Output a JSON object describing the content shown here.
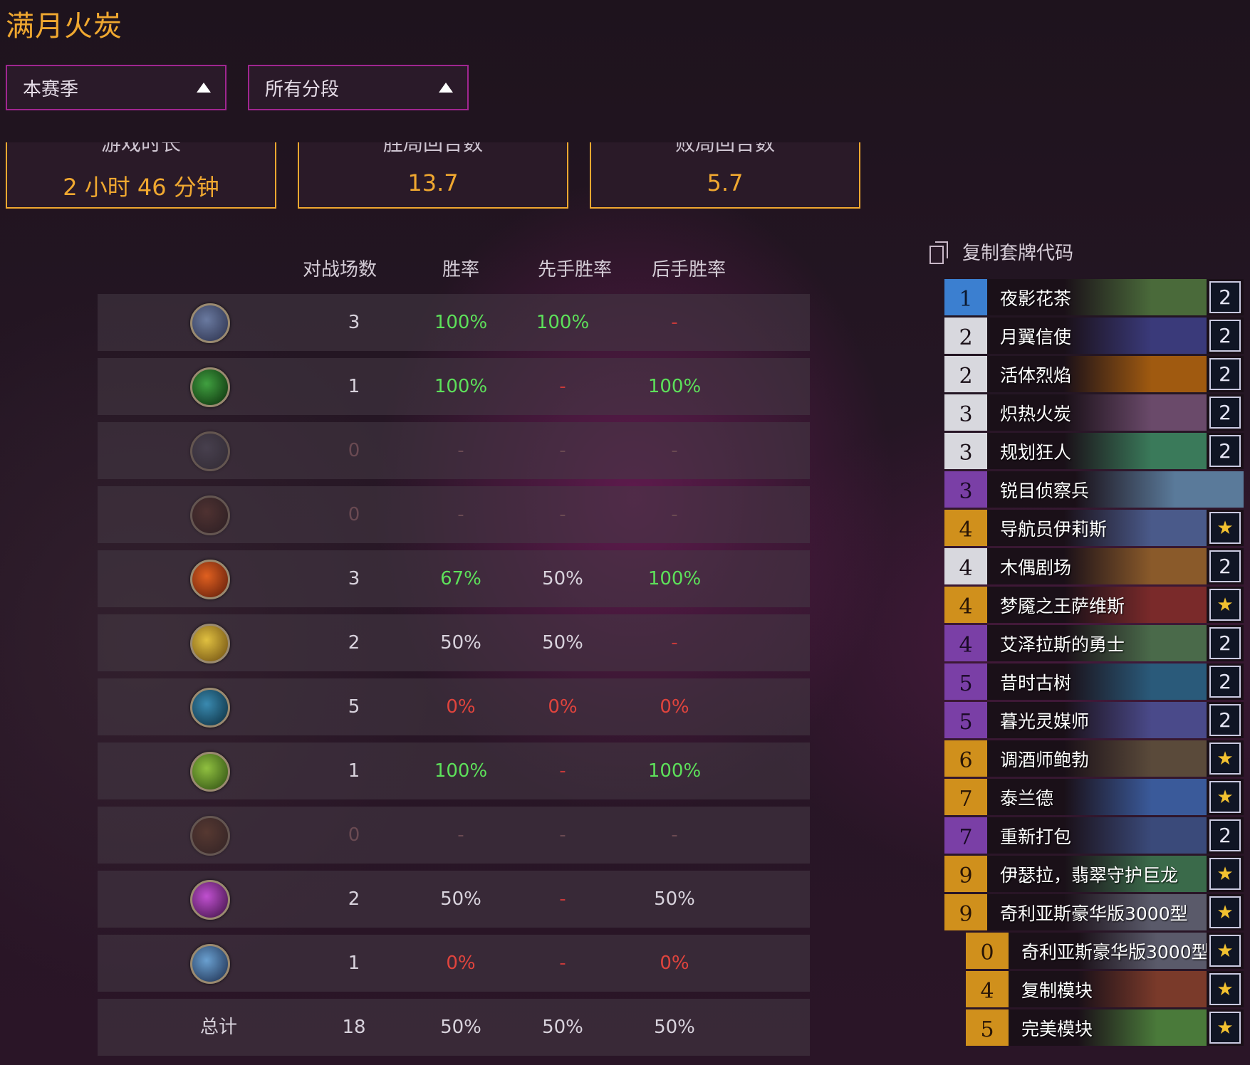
{
  "page": {
    "title": "满月火炭"
  },
  "filters": {
    "season": "本赛季",
    "rank": "所有分段"
  },
  "stats": [
    {
      "label": "游戏时长",
      "value": "2 小时 46 分钟"
    },
    {
      "label": "胜局回合数",
      "value": "13.7"
    },
    {
      "label": "败局回合数",
      "value": "5.7"
    }
  ],
  "table": {
    "headers": [
      "对战场数",
      "胜率",
      "先手胜率",
      "后手胜率"
    ],
    "rows": [
      {
        "icon": "class-icon-1",
        "games": "3",
        "winrate": "100%",
        "first": "100%",
        "second": "-"
      },
      {
        "icon": "class-icon-2",
        "games": "1",
        "winrate": "100%",
        "first": "-",
        "second": "100%"
      },
      {
        "icon": "class-icon-3",
        "games": "0",
        "winrate": "-",
        "first": "-",
        "second": "-"
      },
      {
        "icon": "class-icon-4",
        "games": "0",
        "winrate": "-",
        "first": "-",
        "second": "-"
      },
      {
        "icon": "class-icon-5",
        "games": "3",
        "winrate": "67%",
        "first": "50%",
        "second": "100%"
      },
      {
        "icon": "class-icon-6",
        "games": "2",
        "winrate": "50%",
        "first": "50%",
        "second": "-"
      },
      {
        "icon": "class-icon-7",
        "games": "5",
        "winrate": "0%",
        "first": "0%",
        "second": "0%"
      },
      {
        "icon": "class-icon-8",
        "games": "1",
        "winrate": "100%",
        "first": "-",
        "second": "100%"
      },
      {
        "icon": "class-icon-9",
        "games": "0",
        "winrate": "-",
        "first": "-",
        "second": "-"
      },
      {
        "icon": "class-icon-10",
        "games": "2",
        "winrate": "50%",
        "first": "-",
        "second": "50%"
      },
      {
        "icon": "class-icon-11",
        "games": "1",
        "winrate": "0%",
        "first": "-",
        "second": "0%"
      }
    ],
    "total": {
      "label": "总计",
      "games": "18",
      "winrate": "50%",
      "first": "50%",
      "second": "50%"
    }
  },
  "deck": {
    "copy_label": "复制套牌代码",
    "cards": [
      {
        "cost": "1",
        "name": "夜影花茶",
        "count": "2",
        "rarity": "free",
        "art": "#4a6a3a"
      },
      {
        "cost": "2",
        "name": "月翼信使",
        "count": "2",
        "rarity": "common",
        "art": "#3a3a7a"
      },
      {
        "cost": "2",
        "name": "活体烈焰",
        "count": "2",
        "rarity": "common",
        "art": "#a05a10"
      },
      {
        "cost": "3",
        "name": "炽热火炭",
        "count": "2",
        "rarity": "common",
        "art": "#6a4a6a"
      },
      {
        "cost": "3",
        "name": "规划狂人",
        "count": "2",
        "rarity": "common",
        "art": "#3a7a5a"
      },
      {
        "cost": "3",
        "name": "锐目侦察兵",
        "count": "",
        "rarity": "epic",
        "art": "#5a7a9a"
      },
      {
        "cost": "4",
        "name": "导航员伊莉斯",
        "count": "★",
        "rarity": "legend",
        "art": "#4a5a8a"
      },
      {
        "cost": "4",
        "name": "木偶剧场",
        "count": "2",
        "rarity": "common",
        "art": "#8a5a2a"
      },
      {
        "cost": "4",
        "name": "梦魇之王萨维斯",
        "count": "★",
        "rarity": "legend",
        "art": "#7a2a2a"
      },
      {
        "cost": "4",
        "name": "艾泽拉斯的勇士",
        "count": "2",
        "rarity": "epic",
        "art": "#4a6a4a"
      },
      {
        "cost": "5",
        "name": "昔时古树",
        "count": "2",
        "rarity": "epic",
        "art": "#2a5a7a"
      },
      {
        "cost": "5",
        "name": "暮光灵媒师",
        "count": "2",
        "rarity": "epic",
        "art": "#4a4a8a"
      },
      {
        "cost": "6",
        "name": "调酒师鲍勃",
        "count": "★",
        "rarity": "legend",
        "art": "#5a4a3a"
      },
      {
        "cost": "7",
        "name": "泰兰德",
        "count": "★",
        "rarity": "legend",
        "art": "#3a5a9a"
      },
      {
        "cost": "7",
        "name": "重新打包",
        "count": "2",
        "rarity": "epic",
        "art": "#3a4a7a"
      },
      {
        "cost": "9",
        "name": "伊瑟拉，翡翠守护巨龙",
        "count": "★",
        "rarity": "legend",
        "art": "#3a6a4a"
      },
      {
        "cost": "9",
        "name": "奇利亚斯豪华版3000型",
        "count": "★",
        "rarity": "legend",
        "art": "#5a5a6a"
      },
      {
        "cost": "0",
        "name": "奇利亚斯豪华版3000型",
        "count": "★",
        "rarity": "legend",
        "art": "#5a5a6a"
      },
      {
        "cost": "4",
        "name": "复制模块",
        "count": "★",
        "rarity": "legend",
        "art": "#7a3a2a"
      },
      {
        "cost": "5",
        "name": "完美模块",
        "count": "★",
        "rarity": "legend",
        "art": "#4a7a3a"
      }
    ]
  },
  "colors": {
    "accent": "#f0a830",
    "dropdown_border": "#a02690",
    "win": "#5de05a",
    "loss": "#e0443d"
  }
}
